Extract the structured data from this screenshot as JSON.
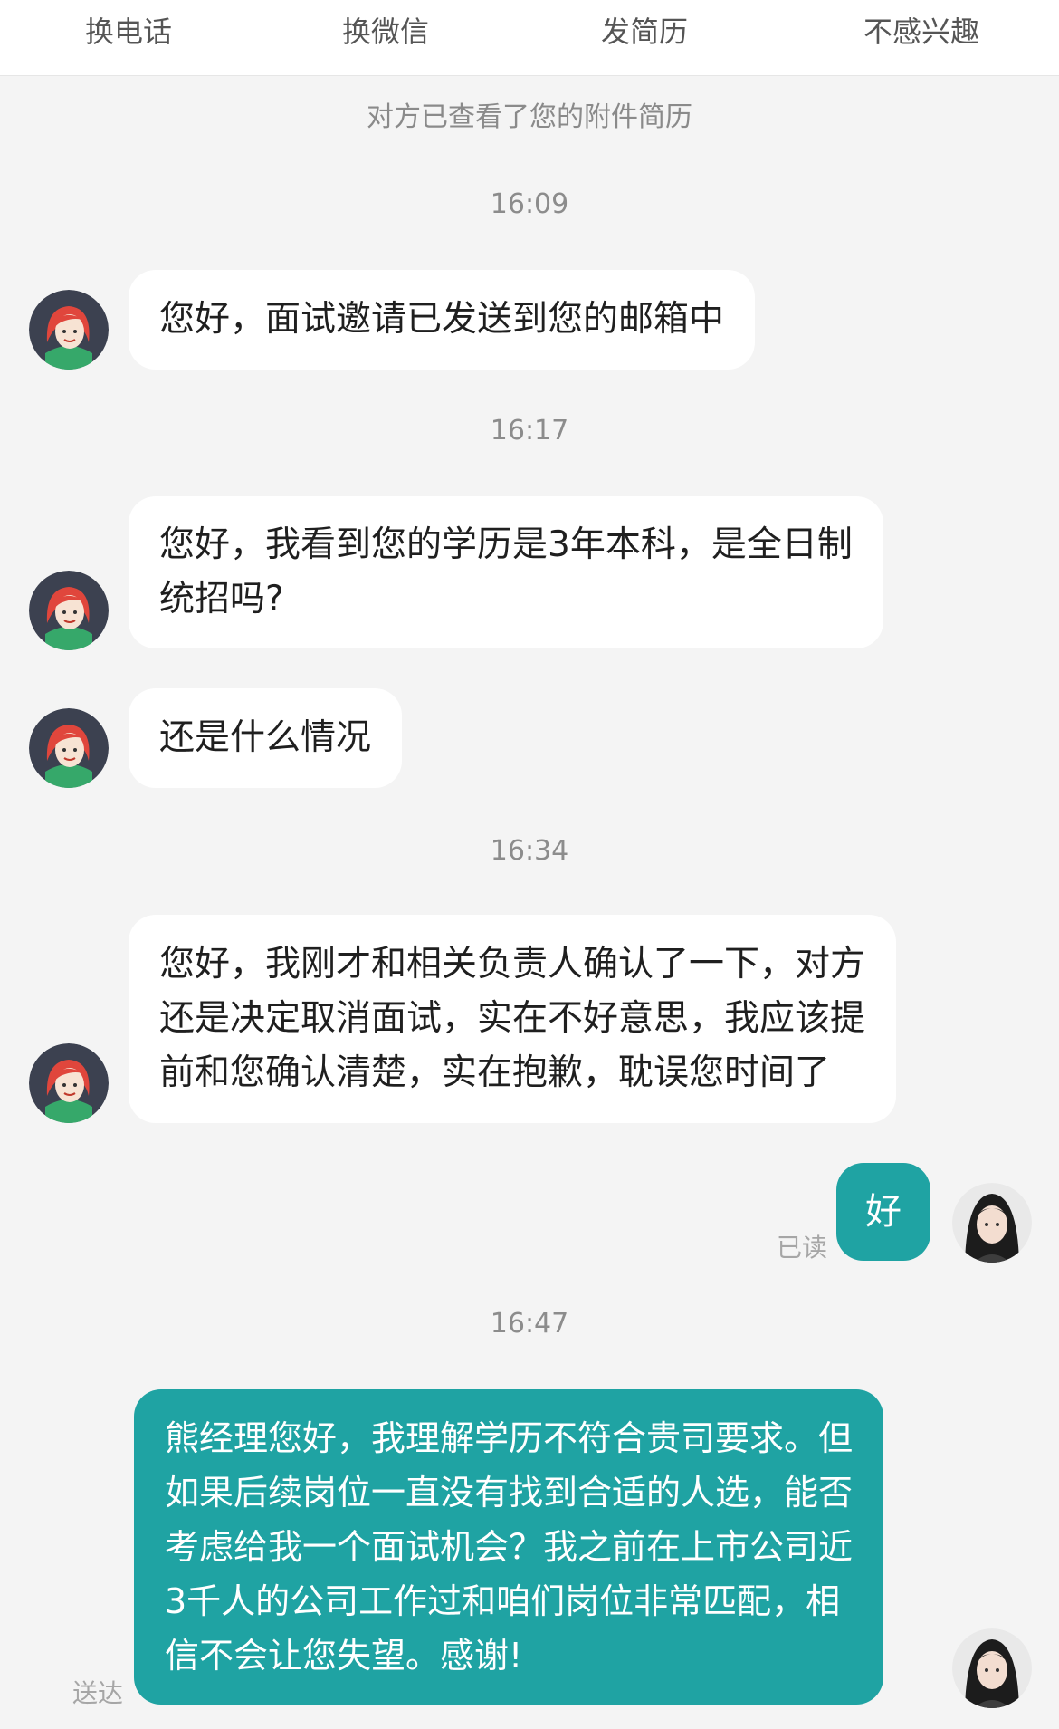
{
  "toolbar": {
    "actions": [
      "换电话",
      "换微信",
      "发简历",
      "不感兴趣"
    ]
  },
  "notice": "对方已查看了您的附件简历",
  "messages": {
    "t1": "16:09",
    "m1": "您好，面试邀请已发送到您的邮箱中",
    "t2": "16:17",
    "m2_lines": [
      "您好，我看到您的学历是3年本科，是全日制",
      "统招吗?"
    ],
    "m3": "还是什么情况",
    "t3": "16:34",
    "m4_lines": [
      "您好，我刚才和相关负责人确认了一下，对方",
      "还是决定取消面试，实在不好意思，我应该提",
      "前和您确认清楚，实在抱歉，耽误您时间了"
    ],
    "m5": "好",
    "m5_status": "已读",
    "t4": "16:47",
    "m6_lines": [
      "熊经理您好，我理解学历不符合贵司要求。但",
      "如果后续岗位一直没有找到合适的人选，能否",
      "考虑给我一个面试机会？我之前在上市公司近",
      "3千人的公司工作过和咱们岗位非常匹配，相",
      "信不会让您失望。感谢!"
    ],
    "m6_status": "送达"
  },
  "colors": {
    "outgoing_bubble": "#1fa3a3",
    "incoming_bubble": "#ffffff",
    "background": "#f4f4f4"
  }
}
